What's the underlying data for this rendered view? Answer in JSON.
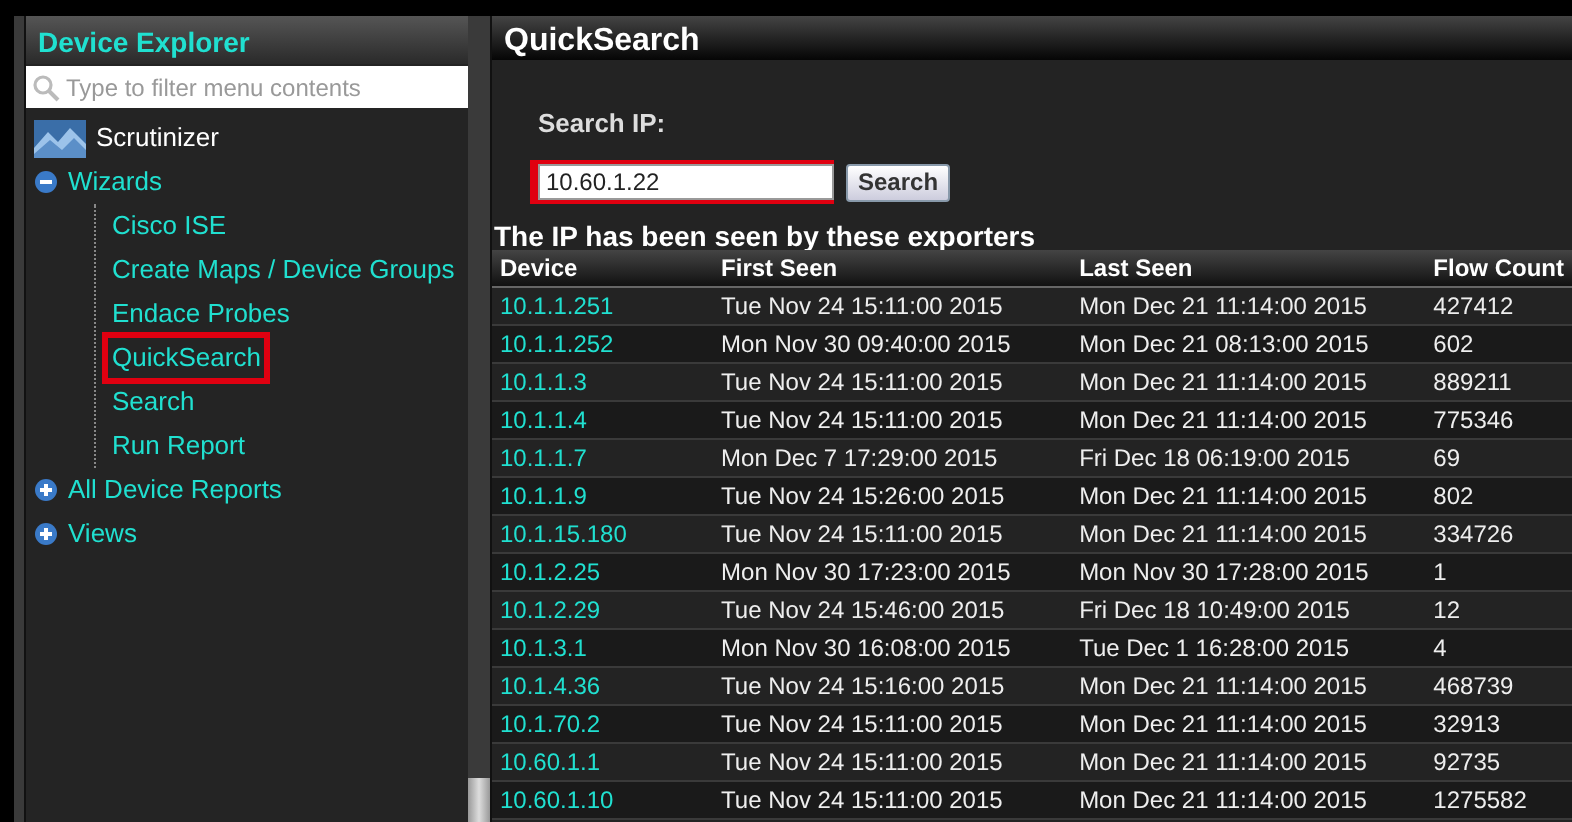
{
  "sidebar": {
    "title": "Device Explorer",
    "filter": {
      "placeholder": "Type to filter menu contents"
    },
    "root": {
      "label": "Scrutinizer"
    },
    "items": [
      {
        "label": "Wizards",
        "expanded": true,
        "children": [
          {
            "label": "Cisco ISE",
            "highlighted": false
          },
          {
            "label": "Create Maps / Device Groups",
            "highlighted": false
          },
          {
            "label": "Endace Probes",
            "highlighted": false
          },
          {
            "label": "QuickSearch",
            "highlighted": true
          },
          {
            "label": "Search",
            "highlighted": false
          },
          {
            "label": "Run Report",
            "highlighted": false
          }
        ]
      },
      {
        "label": "All Device Reports",
        "expanded": false
      },
      {
        "label": "Views",
        "expanded": false
      }
    ]
  },
  "main": {
    "title": "QuickSearch",
    "search_label": "Search IP:",
    "search_field": {
      "value": "10.60.1.22",
      "highlighted": true
    },
    "search_button": "Search",
    "table_caption": "The IP has been seen by these exporters",
    "table": {
      "columns": [
        "Device",
        "First Seen",
        "Last Seen",
        "Flow Count"
      ],
      "rows": [
        [
          "10.1.1.251",
          "Tue Nov 24 15:11:00 2015",
          "Mon Dec 21 11:14:00 2015",
          "427412"
        ],
        [
          "10.1.1.252",
          "Mon Nov 30 09:40:00 2015",
          "Mon Dec 21 08:13:00 2015",
          "602"
        ],
        [
          "10.1.1.3",
          "Tue Nov 24 15:11:00 2015",
          "Mon Dec 21 11:14:00 2015",
          "889211"
        ],
        [
          "10.1.1.4",
          "Tue Nov 24 15:11:00 2015",
          "Mon Dec 21 11:14:00 2015",
          "775346"
        ],
        [
          "10.1.1.7",
          "Mon Dec 7 17:29:00 2015",
          "Fri Dec 18 06:19:00 2015",
          "69"
        ],
        [
          "10.1.1.9",
          "Tue Nov 24 15:26:00 2015",
          "Mon Dec 21 11:14:00 2015",
          "802"
        ],
        [
          "10.1.15.180",
          "Tue Nov 24 15:11:00 2015",
          "Mon Dec 21 11:14:00 2015",
          "334726"
        ],
        [
          "10.1.2.25",
          "Mon Nov 30 17:23:00 2015",
          "Mon Nov 30 17:28:00 2015",
          "1"
        ],
        [
          "10.1.2.29",
          "Tue Nov 24 15:46:00 2015",
          "Fri Dec 18 10:49:00 2015",
          "12"
        ],
        [
          "10.1.3.1",
          "Mon Nov 30 16:08:00 2015",
          "Tue Dec 1 16:28:00 2015",
          "4"
        ],
        [
          "10.1.4.36",
          "Tue Nov 24 15:16:00 2015",
          "Mon Dec 21 11:14:00 2015",
          "468739"
        ],
        [
          "10.1.70.2",
          "Tue Nov 24 15:11:00 2015",
          "Mon Dec 21 11:14:00 2015",
          "32913"
        ],
        [
          "10.60.1.1",
          "Tue Nov 24 15:11:00 2015",
          "Mon Dec 21 11:14:00 2015",
          "92735"
        ],
        [
          "10.60.1.10",
          "Tue Nov 24 15:11:00 2015",
          "Mon Dec 21 11:14:00 2015",
          "1275582"
        ]
      ]
    }
  }
}
